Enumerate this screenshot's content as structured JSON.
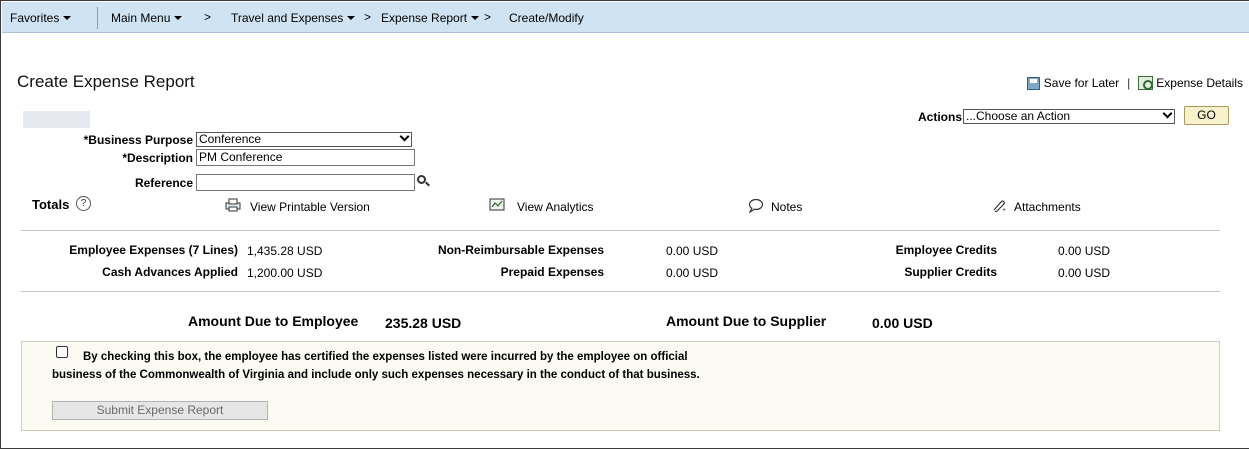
{
  "nav": {
    "favorites": "Favorites",
    "main_menu": "Main Menu",
    "breadcrumb": [
      "Travel and Expenses",
      "Expense Report",
      "Create/Modify"
    ],
    "chevron": ">"
  },
  "page": {
    "title": "Create Expense Report",
    "save_for_later": "Save for Later",
    "pipe": "|",
    "expense_details": "Expense Details"
  },
  "form": {
    "business_purpose_label": "*Business Purpose",
    "business_purpose_value": "Conference",
    "description_label": "*Description",
    "description_value": "PM Conference",
    "reference_label": "Reference",
    "reference_value": "",
    "actions_label": "Actions",
    "actions_value": "...Choose an Action",
    "go_label": "GO"
  },
  "toolbar": {
    "totals_label": "Totals",
    "help_glyph": "?",
    "view_printable": "View Printable Version",
    "view_analytics": "View Analytics",
    "notes": "Notes",
    "attachments": "Attachments"
  },
  "summary": {
    "employee_expenses_label": "Employee Expenses (7 Lines)",
    "employee_expenses_value": "1,435.28  USD",
    "cash_advances_label": "Cash Advances Applied",
    "cash_advances_value": "1,200.00  USD",
    "non_reimbursable_label": "Non-Reimbursable Expenses",
    "non_reimbursable_value": "0.00  USD",
    "prepaid_label": "Prepaid Expenses",
    "prepaid_value": "0.00  USD",
    "employee_credits_label": "Employee Credits",
    "employee_credits_value": "0.00  USD",
    "supplier_credits_label": "Supplier Credits",
    "supplier_credits_value": "0.00  USD"
  },
  "due": {
    "employee_label": "Amount Due to Employee",
    "employee_value": "235.28  USD",
    "supplier_label": "Amount Due to Supplier",
    "supplier_value": "0.00  USD"
  },
  "certification": {
    "text": "By checking this box, the employee has certified the expenses listed were incurred by the employee on official business of the Commonwealth of Virginia and include only such expenses necessary in the conduct of that business.",
    "checked": false,
    "submit_label": "Submit Expense Report"
  }
}
